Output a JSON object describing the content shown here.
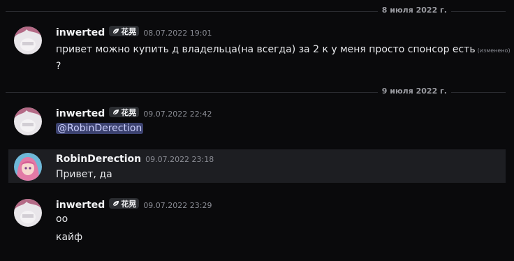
{
  "dividers": [
    {
      "label": "8 июля 2022 г."
    },
    {
      "label": "9 июля 2022 г."
    }
  ],
  "messages": [
    {
      "author": "inwerted",
      "tag": "花晃",
      "timestamp": "08.07.2022 19:01",
      "lines": [
        "привет можно купить д владельца(на всегда) за 2 к у меня просто спонсор есть",
        "?"
      ],
      "edited": "(изменено)"
    },
    {
      "author": "inwerted",
      "tag": "花晃",
      "timestamp": "09.07.2022 22:42",
      "mention": "@RobinDerection"
    },
    {
      "author": "RobinDerection",
      "timestamp": "09.07.2022 23:18",
      "lines": [
        "Привет, да"
      ]
    },
    {
      "author": "inwerted",
      "tag": "花晃",
      "timestamp": "09.07.2022 23:29",
      "lines": [
        "оо",
        "кайф"
      ]
    }
  ],
  "colors": {
    "background": "#0a0a0c",
    "highlight_row": "#1d1e22",
    "mention_bg": "#3c4270",
    "mention_text": "#c9cdfb"
  }
}
